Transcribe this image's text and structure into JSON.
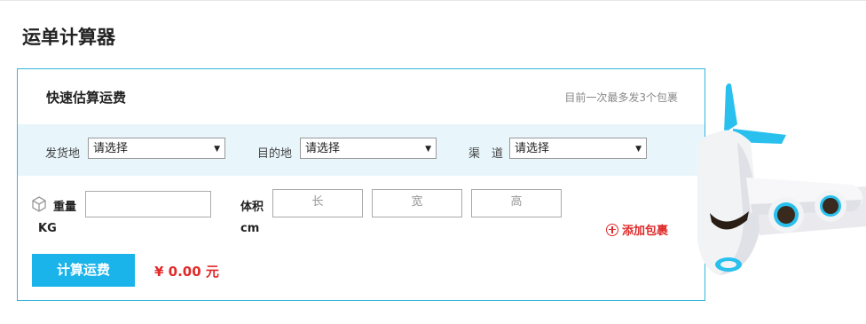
{
  "page": {
    "title": "运单计算器"
  },
  "card": {
    "title": "快速估算运费",
    "note": "目前一次最多发3个包裹"
  },
  "route": {
    "origin_label": "发货地",
    "origin_value": "请选择",
    "dest_label": "目的地",
    "dest_value": "请选择",
    "channel_label": "渠　道",
    "channel_value": "请选择"
  },
  "package": {
    "weight_label": "重量",
    "weight_value": "",
    "weight_unit": "KG",
    "volume_label": "体积",
    "length_placeholder": "长",
    "width_placeholder": "宽",
    "height_placeholder": "高",
    "volume_unit": "cm",
    "add_label": "添加包裹"
  },
  "actions": {
    "calc_label": "计算运费",
    "price": "¥ 0.00 元"
  },
  "icons": {
    "package": "box-icon",
    "add": "plus-circle-icon",
    "dropdown": "chevron-down-icon",
    "illustration": "airplane-illustration"
  },
  "colors": {
    "accent": "#1ab3ea",
    "border": "#35b4dc",
    "band": "#e8f5fb",
    "price": "#e02a2a"
  }
}
